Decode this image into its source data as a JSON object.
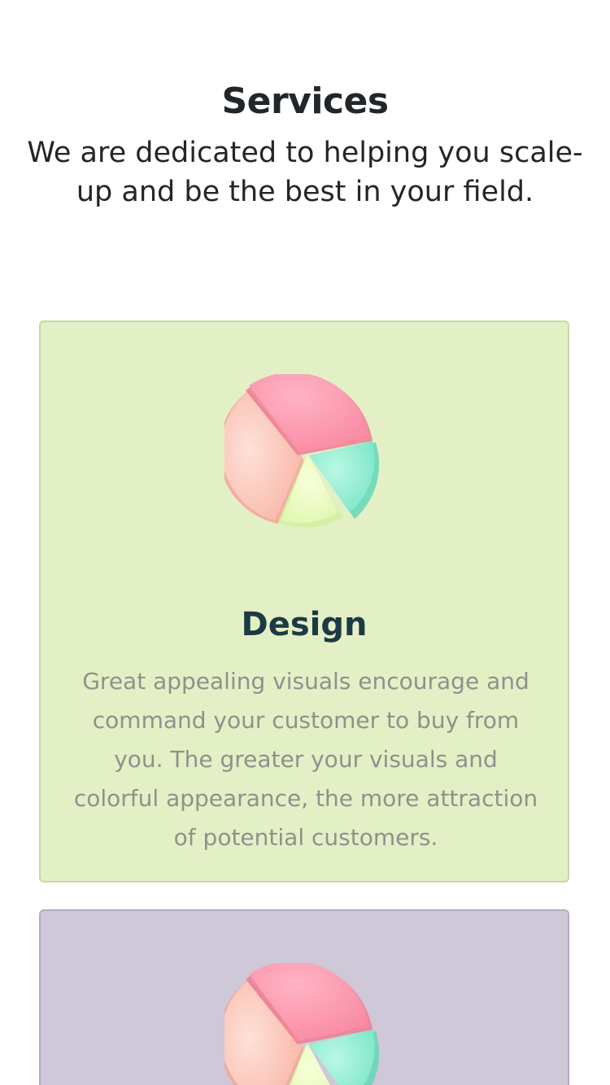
{
  "header": {
    "title": "Services",
    "subtitle": "We are dedicated to helping you scale-up and be the best in your field."
  },
  "services": [
    {
      "title": "Design",
      "description": "Great appealing visuals encourage and command your customer to buy from you. The greater your visuals and colorful appearance, the more attraction of potential customers.",
      "icon": "pie-chart-icon",
      "background": "#e3f0c5"
    },
    {
      "icon": "pie-chart-icon",
      "background": "#cec8d8"
    }
  ],
  "colors": {
    "heading": "#222629",
    "card_title": "#1c3a45",
    "card_text": "#8f918c"
  }
}
